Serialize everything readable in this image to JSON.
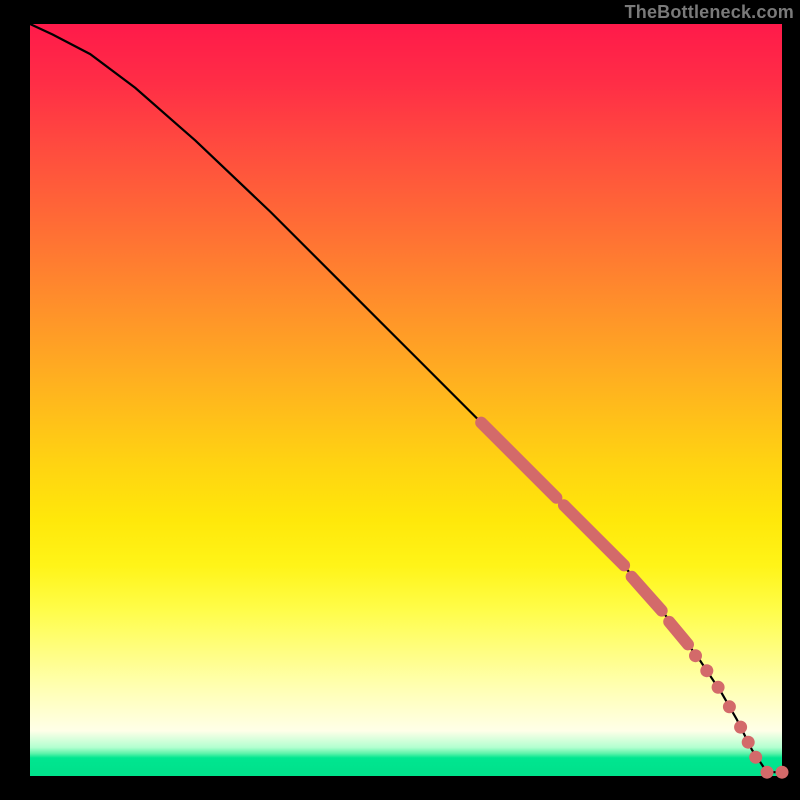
{
  "attribution": "TheBottleneck.com",
  "colors": {
    "gradient_top": "#ff1a4a",
    "gradient_mid": "#ffe80a",
    "gradient_bottom": "#00e28c",
    "curve": "#000000",
    "points": "#d36a6a",
    "frame": "#000000"
  },
  "chart_data": {
    "type": "line",
    "title": "",
    "xlabel": "",
    "ylabel": "",
    "xlim": [
      0,
      100
    ],
    "ylim": [
      0,
      100
    ],
    "grid": false,
    "legend": "none",
    "series": [
      {
        "name": "curve",
        "x": [
          0,
          3,
          8,
          14,
          22,
          32,
          42,
          52,
          60,
          66,
          70,
          74,
          78,
          82,
          86,
          89,
          92,
          94,
          96,
          98,
          100
        ],
        "y": [
          100,
          98.6,
          96.0,
          91.5,
          84.5,
          75.0,
          65.0,
          55.0,
          47.0,
          41.0,
          37.0,
          33.0,
          29.0,
          24.5,
          19.5,
          15.5,
          11.0,
          7.5,
          3.5,
          0.5,
          0.5
        ]
      }
    ],
    "highlight_segments": [
      {
        "x0": 60,
        "y0": 47.0,
        "x1": 70,
        "y1": 37.0
      },
      {
        "x0": 71,
        "y0": 36.0,
        "x1": 79,
        "y1": 28.0
      },
      {
        "x0": 80,
        "y0": 26.5,
        "x1": 84,
        "y1": 22.0
      },
      {
        "x0": 85,
        "y0": 20.5,
        "x1": 87.5,
        "y1": 17.5
      }
    ],
    "highlight_points": [
      {
        "x": 88.5,
        "y": 16.0
      },
      {
        "x": 90.0,
        "y": 14.0
      },
      {
        "x": 91.5,
        "y": 11.8
      },
      {
        "x": 93.0,
        "y": 9.2
      },
      {
        "x": 94.5,
        "y": 6.5
      },
      {
        "x": 95.5,
        "y": 4.5
      },
      {
        "x": 96.5,
        "y": 2.5
      },
      {
        "x": 98.0,
        "y": 0.5
      },
      {
        "x": 100.0,
        "y": 0.5
      }
    ]
  }
}
